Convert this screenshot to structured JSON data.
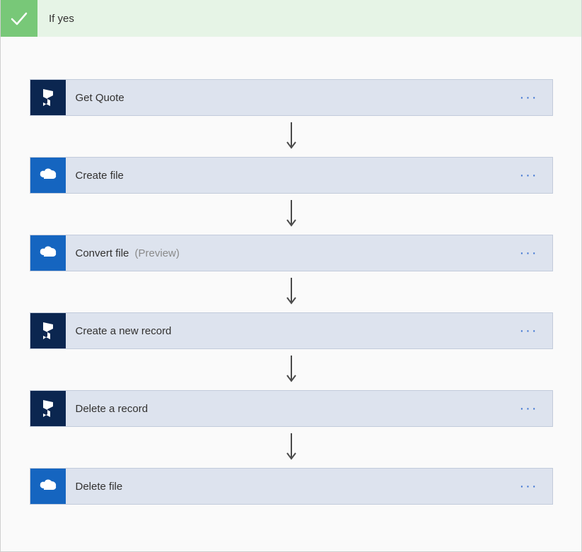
{
  "header": {
    "label": "If yes"
  },
  "steps": [
    {
      "icon": "dynamics",
      "label": "Get Quote",
      "suffix": ""
    },
    {
      "icon": "onedrive",
      "label": "Create file",
      "suffix": ""
    },
    {
      "icon": "onedrive",
      "label": "Convert file",
      "suffix": "(Preview)"
    },
    {
      "icon": "dynamics",
      "label": "Create a new record",
      "suffix": ""
    },
    {
      "icon": "dynamics",
      "label": "Delete a record",
      "suffix": ""
    },
    {
      "icon": "onedrive",
      "label": "Delete file",
      "suffix": ""
    }
  ],
  "menu_label": "···"
}
